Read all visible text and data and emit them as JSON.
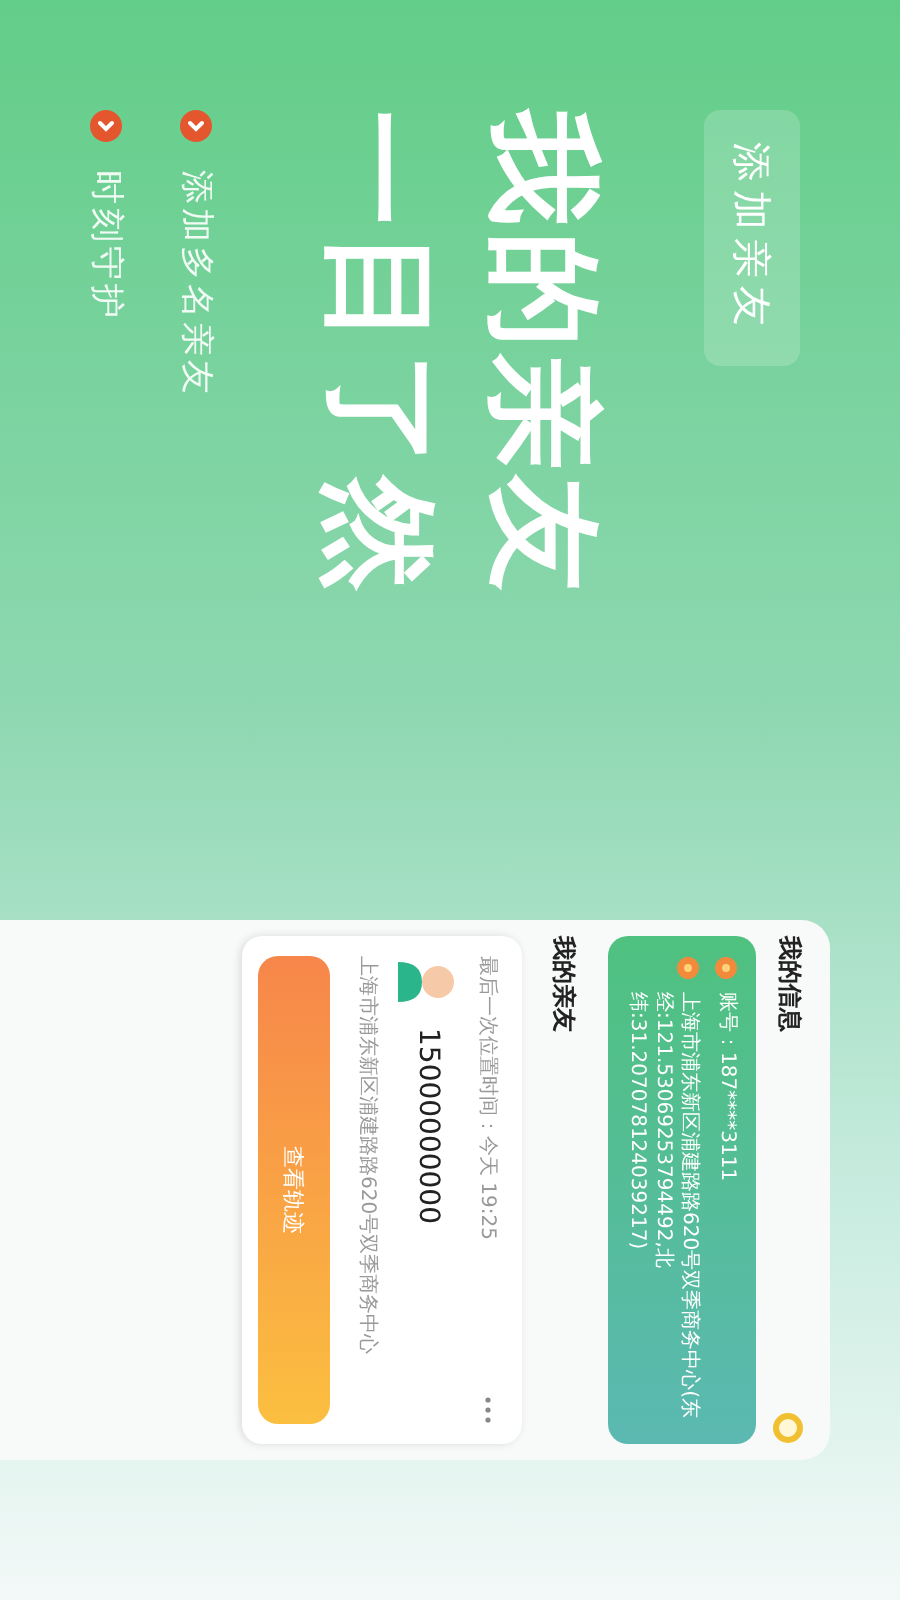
{
  "promo": {
    "add_button": "添加亲友",
    "headline": [
      "我的亲友",
      "一目了然"
    ],
    "features": [
      "添加多名亲友",
      "时刻守护"
    ]
  },
  "panel": {
    "my_info": {
      "title": "我的信息",
      "account": "账号：187****3111",
      "address": "上海市浦东新区浦建路路620号双季商务中心(东经:121.53069253794492,北纬:31.207078124039217)"
    },
    "my_friends": {
      "title": "我的亲友",
      "friends": [
        {
          "last_location_time": "最后一次位置时间：今天 19:25",
          "phone": "15000000000",
          "address": "上海市浦东新区浦建路路620号双季商务中心",
          "button": "查看轨迹"
        }
      ]
    }
  }
}
